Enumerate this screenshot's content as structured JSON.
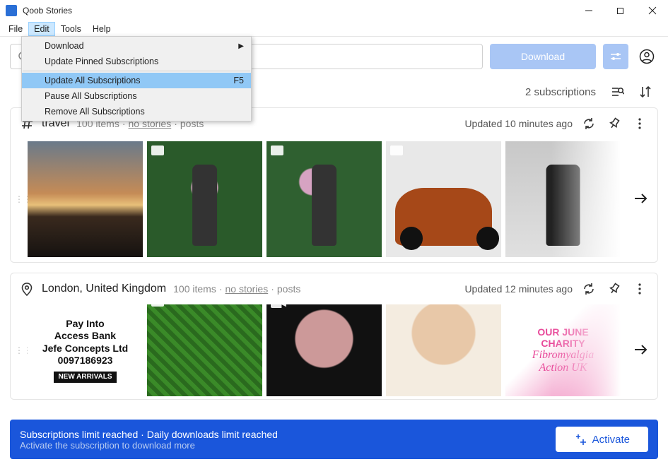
{
  "app_title": "Qoob Stories",
  "menu": {
    "file": "File",
    "edit": "Edit",
    "tools": "Tools",
    "help": "Help"
  },
  "edit_menu": {
    "download": "Download",
    "update_pinned": "Update Pinned Subscriptions",
    "update_all": "Update All Subscriptions",
    "update_all_shortcut": "F5",
    "pause_all": "Pause All Subscriptions",
    "remove_all": "Remove All Subscriptions"
  },
  "toolbar": {
    "download": "Download"
  },
  "status": {
    "subs_count": "2 subscriptions"
  },
  "subs": [
    {
      "name": "travel",
      "items": "100 items",
      "no_stories": "no stories",
      "posts": "posts",
      "updated": "Updated 10 minutes ago"
    },
    {
      "name": "London, United Kingdom",
      "items": "100 items",
      "no_stories": "no stories",
      "posts": "posts",
      "updated": "Updated 12 minutes ago"
    }
  ],
  "bank_tile": {
    "l1": "Pay Into",
    "l2": "Access Bank",
    "l3": "Jefe Concepts Ltd",
    "l4": "0097186923",
    "l5": "NEW ARRIVALS"
  },
  "charity_tile": {
    "l1": "OUR JUNE",
    "l2": "CHARITY",
    "l3": "Fibromyalgia",
    "l4": "Action UK"
  },
  "banner": {
    "main": "Subscriptions limit reached · Daily downloads limit reached",
    "sub": "Activate the subscription to download more",
    "activate": "Activate"
  }
}
